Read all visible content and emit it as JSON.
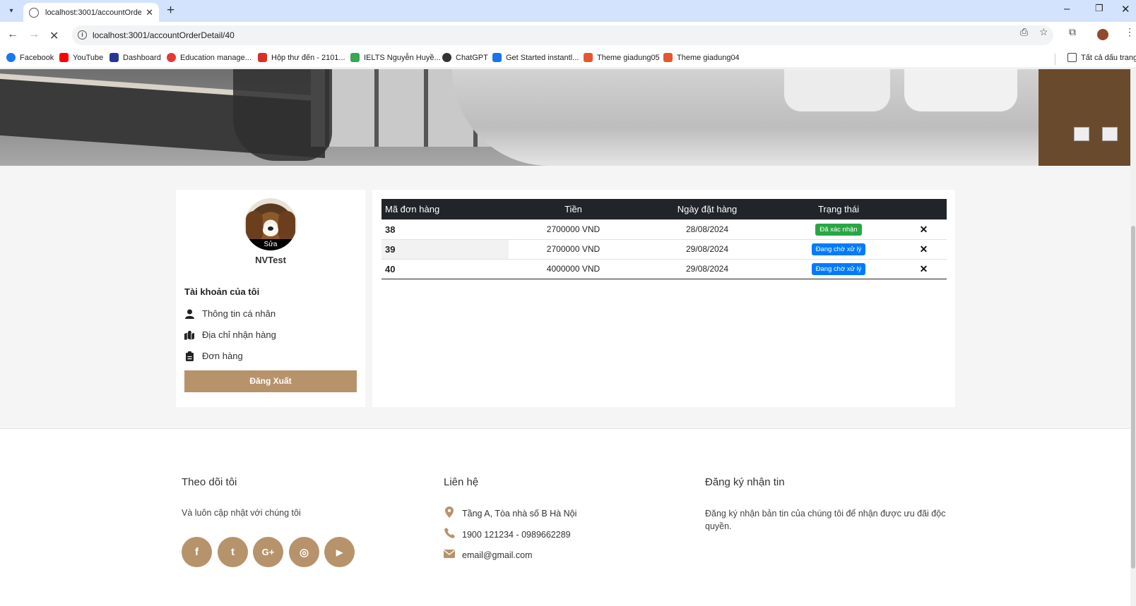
{
  "browser": {
    "tab_title": "localhost:3001/accountOrderDe",
    "url": "localhost:3001/accountOrderDetail/40",
    "bookmarks": [
      {
        "label": "Facebook",
        "color": "#1877f2"
      },
      {
        "label": "YouTube",
        "color": "#ff0000"
      },
      {
        "label": "Dashboard",
        "color": "#283593"
      },
      {
        "label": "Education manage...",
        "color": "#e53935"
      },
      {
        "label": "Hộp thư đến - 2101...",
        "color": "#d93025"
      },
      {
        "label": "IELTS Nguyễn Huyề...",
        "color": "#34a853"
      },
      {
        "label": "ChatGPT",
        "color": "#333333"
      },
      {
        "label": "Get Started instantl...",
        "color": "#1a73e8"
      },
      {
        "label": "Theme giadung05",
        "color": "#e4572e"
      },
      {
        "label": "Theme giadung04",
        "color": "#e4572e"
      }
    ],
    "all_bookmarks": "Tất cả dấu trang"
  },
  "account": {
    "avatar_edit": "Sửa",
    "username": "NVTest",
    "section_title": "Tài khoản của tôi",
    "menu": [
      {
        "label": "Thông tin cá nhân",
        "icon": "user-icon"
      },
      {
        "label": "Địa chỉ nhận hàng",
        "icon": "map-icon"
      },
      {
        "label": "Đơn hàng",
        "icon": "clipboard-icon"
      }
    ],
    "logout": "Đăng Xuất"
  },
  "orders": {
    "headers": [
      "Mã đơn hàng",
      "Tiền",
      "Ngày đặt hàng",
      "Trạng thái",
      ""
    ],
    "rows": [
      {
        "id": "38",
        "amount": "2700000 VND",
        "date": "28/08/2024",
        "status": "Đã xác nhận",
        "status_color": "#28a745"
      },
      {
        "id": "39",
        "amount": "2700000 VND",
        "date": "29/08/2024",
        "status": "Đang chờ xử lý",
        "status_color": "#007bff"
      },
      {
        "id": "40",
        "amount": "4000000 VND",
        "date": "29/08/2024",
        "status": "Đang chờ xử lý",
        "status_color": "#007bff"
      }
    ],
    "delete_glyph": "✕"
  },
  "footer": {
    "follow": {
      "title": "Theo dõi tôi",
      "text": "Và luôn cập nhật với chúng tôi",
      "socials": [
        {
          "icon": "facebook-icon",
          "glyph": "f"
        },
        {
          "icon": "twitter-icon",
          "glyph": "t"
        },
        {
          "icon": "google-plus-icon",
          "glyph": "G+"
        },
        {
          "icon": "instagram-icon",
          "glyph": "◎"
        },
        {
          "icon": "youtube-icon",
          "glyph": "▶"
        }
      ]
    },
    "contact": {
      "title": "Liên hệ",
      "address": "Tầng A, Tòa nhà số B Hà Nội",
      "phone": "1900 121234 - 0989662289",
      "email": "email@gmail.com"
    },
    "newsletter": {
      "title": "Đăng ký nhận tin",
      "text": "Đăng ký nhận bản tin của chúng tôi để nhận được ưu đãi độc quyền."
    }
  },
  "colors": {
    "accent": "#b7936b",
    "table_header": "#212529"
  }
}
